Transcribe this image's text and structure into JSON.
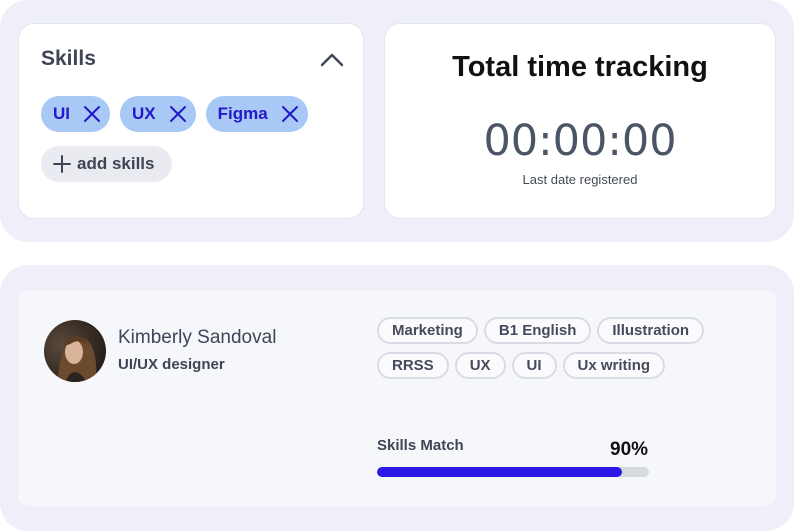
{
  "skills": {
    "title": "Skills",
    "chips": [
      "UI",
      "UX",
      "Figma"
    ],
    "add_label": "add skills"
  },
  "time_tracking": {
    "title": "Total time tracking",
    "value": "00:00:00",
    "subtitle": "Last date registered"
  },
  "profile": {
    "name": "Kimberly Sandoval",
    "role": "UI/UX designer",
    "tags": [
      "Marketing",
      "B1 English",
      "Illustration",
      "RRSS",
      "UX",
      "UI",
      "Ux writing"
    ],
    "match_label": "Skills Match",
    "match_percent_text": "90%",
    "match_fraction": 0.9
  },
  "colors": {
    "accent": "#2c16e8",
    "chip_bg": "#a8c8f6",
    "chip_text": "#2418c8",
    "panel_bg": "#eeeff8"
  }
}
